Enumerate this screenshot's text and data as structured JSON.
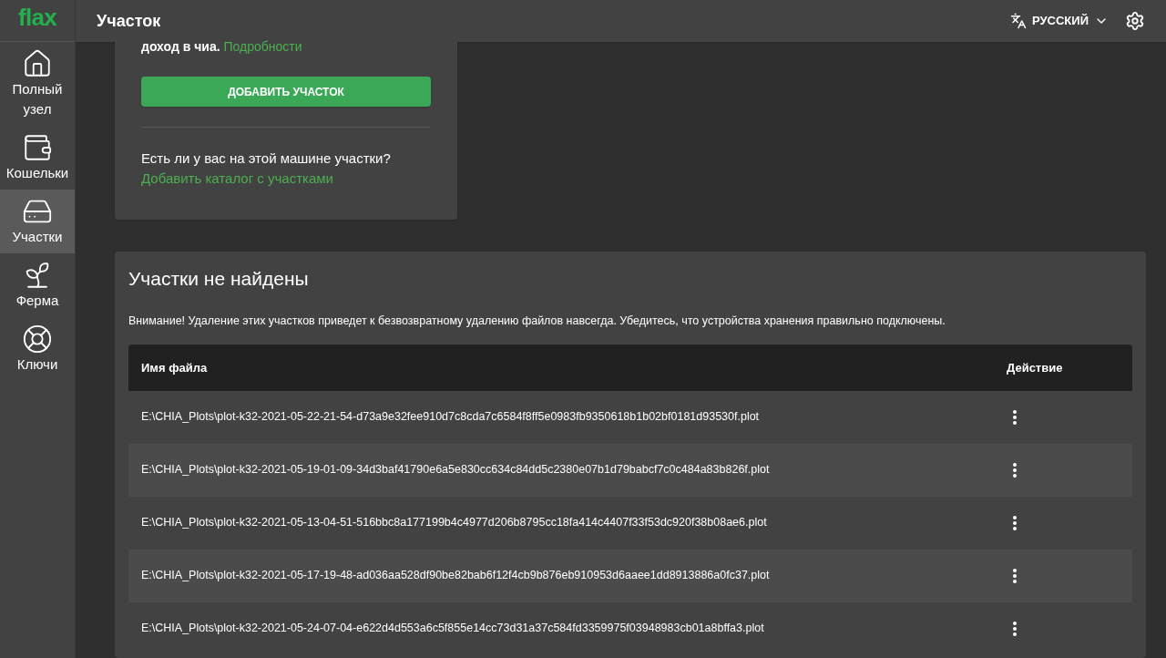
{
  "logo": "flax",
  "header": {
    "title": "Участок",
    "language": "РУССКИЙ"
  },
  "sidebar": {
    "items": [
      {
        "label": "Полный узел",
        "kind": "home",
        "selected": false
      },
      {
        "label": "Кошельки",
        "kind": "wallet",
        "selected": false
      },
      {
        "label": "Участки",
        "kind": "drive",
        "selected": true
      },
      {
        "label": "Ферма",
        "kind": "sprout",
        "selected": false
      },
      {
        "label": "Ключи",
        "kind": "lifebuoy",
        "selected": false
      }
    ]
  },
  "add_card": {
    "text_start": "доход в чиа.",
    "details_link": "Подробности",
    "add_button": "ДОБАВИТЬ УЧАСТОК",
    "question": "Есть ли у вас на этой машине участки?",
    "add_dir_link": "Добавить каталог с участками"
  },
  "not_found": {
    "title": "Участки не найдены",
    "warning": "Внимание! Удаление этих участков приведет к безвозвратному удалению файлов навсегда. Убедитесь, что устройства хранения правильно подключены.",
    "table": {
      "columns": [
        "Имя файла",
        "Действие"
      ],
      "rows": [
        {
          "file": "E:\\CHIA_Plots\\plot-k32-2021-05-22-21-54-d73a9e32fee910d7c8cda7c6584f8ff5e0983fb9350618b1b02bf0181d93530f.plot"
        },
        {
          "file": "E:\\CHIA_Plots\\plot-k32-2021-05-19-01-09-34d3baf41790e6a5e830cc634c84dd5c2380e07b1d79babcf7c0c484a83b826f.plot"
        },
        {
          "file": "E:\\CHIA_Plots\\plot-k32-2021-05-13-04-51-516bbc8a177199b4c4977d206b8795cc18fa414c4407f33f53dc920f38b08ae6.plot"
        },
        {
          "file": "E:\\CHIA_Plots\\plot-k32-2021-05-17-19-48-ad036aa528df90be82bab6f12f4cb9b876eb910953d6aaee1dd8913886a0fc37.plot"
        },
        {
          "file": "E:\\CHIA_Plots\\plot-k32-2021-05-24-07-04-e622d4d553a6c5f855e14cc73d31a37c584fd3359975f03948983cb01a8bffa3.plot"
        }
      ]
    }
  }
}
